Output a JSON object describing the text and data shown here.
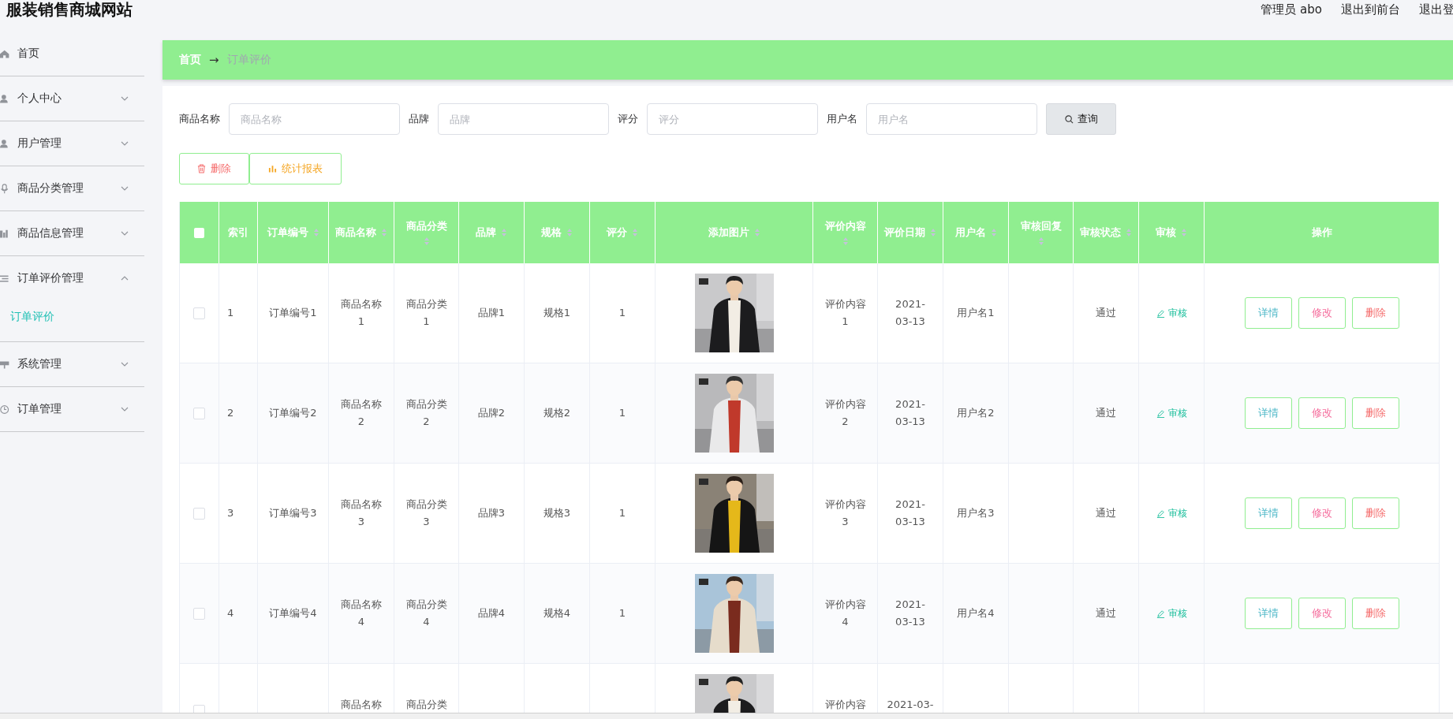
{
  "header": {
    "title": "服装销售商城网站",
    "links": [
      "管理员 abo",
      "退出到前台",
      "退出登"
    ]
  },
  "sidebar": {
    "items": [
      {
        "label": "首页",
        "kind": "link"
      },
      {
        "label": "个人中心",
        "kind": "menu",
        "expanded": false
      },
      {
        "label": "用户管理",
        "kind": "menu",
        "expanded": false
      },
      {
        "label": "商品分类管理",
        "kind": "menu",
        "expanded": false
      },
      {
        "label": "商品信息管理",
        "kind": "menu",
        "expanded": false
      },
      {
        "label": "订单评价管理",
        "kind": "menu",
        "expanded": true,
        "children": [
          {
            "label": "订单评价",
            "selected": true
          }
        ]
      },
      {
        "label": "系统管理",
        "kind": "menu",
        "expanded": false
      },
      {
        "label": "订单管理",
        "kind": "menu",
        "expanded": false
      }
    ]
  },
  "breadcrumb": {
    "home": "首页",
    "separator": "→",
    "current": "订单评价"
  },
  "search": {
    "fields": [
      {
        "label": "商品名称",
        "placeholder": "商品名称"
      },
      {
        "label": "品牌",
        "placeholder": "品牌"
      },
      {
        "label": "评分",
        "placeholder": "评分"
      },
      {
        "label": "用户名",
        "placeholder": "用户名"
      }
    ],
    "button": "查询"
  },
  "actions": [
    {
      "kind": "delete",
      "label": "删除"
    },
    {
      "kind": "report",
      "label": "统计报表"
    }
  ],
  "table": {
    "columns": [
      {
        "kind": "check",
        "sortable": false
      },
      {
        "label": "索引",
        "sortable": false
      },
      {
        "label": "订单编号",
        "sortable": true
      },
      {
        "label": "商品名称",
        "sortable": true
      },
      {
        "label": "商品分类",
        "sortable": true
      },
      {
        "label": "品牌",
        "sortable": true
      },
      {
        "label": "规格",
        "sortable": true
      },
      {
        "label": "评分",
        "sortable": true
      },
      {
        "label": "添加图片",
        "sortable": true
      },
      {
        "label": "评价内容",
        "sortable": true
      },
      {
        "label": "评价日期",
        "sortable": true
      },
      {
        "label": "用户名",
        "sortable": true
      },
      {
        "label": "审核回复",
        "sortable": true
      },
      {
        "label": "审核状态",
        "sortable": true
      },
      {
        "label": "审核",
        "sortable": true
      },
      {
        "label": "操作",
        "sortable": false
      }
    ],
    "select_all_checked": false,
    "rows": [
      {
        "checked": false,
        "index": "1",
        "order_no": "订单编号1",
        "name": "商品名称1",
        "category": "商品分类1",
        "brand": "品牌1",
        "spec": "规格1",
        "rating": "1",
        "image": {
          "kind": "picture"
        },
        "content": "评价内容1",
        "date": "2021-03-13",
        "user": "用户名1",
        "status": "通过",
        "audit": "审核",
        "buttons": [
          "详情",
          "修改",
          "删除"
        ]
      },
      {
        "checked": false,
        "index": "2",
        "order_no": "订单编号2",
        "name": "商品名称2",
        "category": "商品分类2",
        "brand": "品牌2",
        "spec": "规格2",
        "rating": "1",
        "image": {
          "kind": "picture"
        },
        "content": "评价内容2",
        "date": "2021-03-13",
        "user": "用户名2",
        "status": "通过",
        "audit": "审核",
        "buttons": [
          "详情",
          "修改",
          "删除"
        ]
      },
      {
        "checked": false,
        "index": "3",
        "order_no": "订单编号3",
        "name": "商品名称3",
        "category": "商品分类3",
        "brand": "品牌3",
        "spec": "规格3",
        "rating": "1",
        "image": {
          "kind": "picture"
        },
        "content": "评价内容3",
        "date": "2021-03-13",
        "user": "用户名3",
        "status": "通过",
        "audit": "审核",
        "buttons": [
          "详情",
          "修改",
          "删除"
        ]
      },
      {
        "checked": false,
        "index": "4",
        "order_no": "订单编号4",
        "name": "商品名称4",
        "category": "商品分类4",
        "brand": "品牌4",
        "spec": "规格4",
        "rating": "1",
        "image": {
          "kind": "picture"
        },
        "content": "评价内容4",
        "date": "2021-03-13",
        "user": "用户名4",
        "status": "通过",
        "audit": "审核",
        "buttons": [
          "详情",
          "修改",
          "删除"
        ]
      },
      {
        "kind": "cut",
        "checked": false,
        "name": "商品名称",
        "category": "商品分类",
        "image": {
          "kind": "picture"
        },
        "content": "评价内容",
        "date": "2021-03-"
      }
    ]
  }
}
